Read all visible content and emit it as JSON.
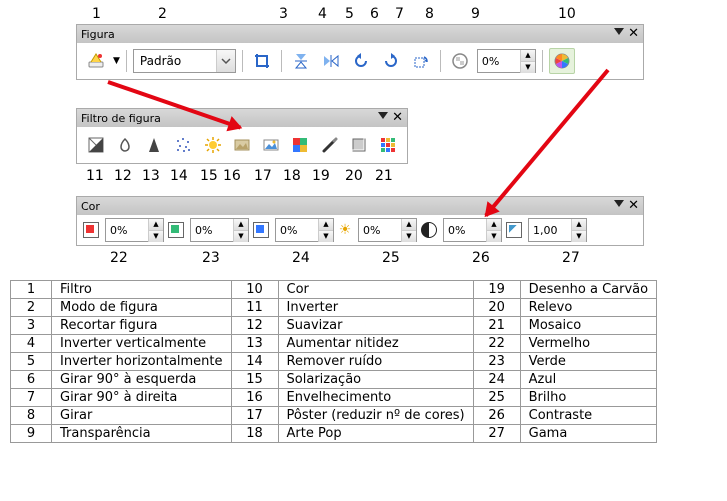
{
  "figura": {
    "title": "Figura",
    "mode_value": "Padrão",
    "percent": "0%"
  },
  "filtro": {
    "title": "Filtro de figura"
  },
  "cor": {
    "title": "Cor",
    "red": "0%",
    "green": "0%",
    "blue": "0%",
    "bright": "0%",
    "contrast": "0%",
    "gamma": "1,00"
  },
  "topnums": [
    "1",
    "2",
    "3",
    "4",
    "5",
    "6",
    "7",
    "8",
    "9",
    "10"
  ],
  "midnums": [
    "11",
    "12",
    "13",
    "14",
    "15",
    "16",
    "17",
    "18",
    "19",
    "20",
    "21"
  ],
  "botnums": [
    "22",
    "23",
    "24",
    "25",
    "26",
    "27"
  ],
  "legend": {
    "c1": [
      {
        "n": "1",
        "t": "Filtro"
      },
      {
        "n": "2",
        "t": "Modo de figura"
      },
      {
        "n": "3",
        "t": "Recortar figura"
      },
      {
        "n": "4",
        "t": "Inverter verticalmente"
      },
      {
        "n": "5",
        "t": "Inverter horizontalmente"
      },
      {
        "n": "6",
        "t": "Girar 90° à esquerda"
      },
      {
        "n": "7",
        "t": "Girar 90° à direita"
      },
      {
        "n": "8",
        "t": "Girar"
      },
      {
        "n": "9",
        "t": "Transparência"
      }
    ],
    "c2": [
      {
        "n": "10",
        "t": "Cor"
      },
      {
        "n": "11",
        "t": "Inverter"
      },
      {
        "n": "12",
        "t": "Suavizar"
      },
      {
        "n": "13",
        "t": "Aumentar nitidez"
      },
      {
        "n": "14",
        "t": "Remover ruído"
      },
      {
        "n": "15",
        "t": "Solarização"
      },
      {
        "n": "16",
        "t": "Envelhecimento"
      },
      {
        "n": "17",
        "t": "Pôster (reduzir nº de cores)"
      },
      {
        "n": "18",
        "t": "Arte Pop"
      }
    ],
    "c3": [
      {
        "n": "19",
        "t": "Desenho a Carvão"
      },
      {
        "n": "20",
        "t": "Relevo"
      },
      {
        "n": "21",
        "t": "Mosaico"
      },
      {
        "n": "22",
        "t": "Vermelho"
      },
      {
        "n": "23",
        "t": "Verde"
      },
      {
        "n": "24",
        "t": "Azul"
      },
      {
        "n": "25",
        "t": "Brilho"
      },
      {
        "n": "26",
        "t": "Contraste"
      },
      {
        "n": "27",
        "t": "Gama"
      }
    ]
  }
}
